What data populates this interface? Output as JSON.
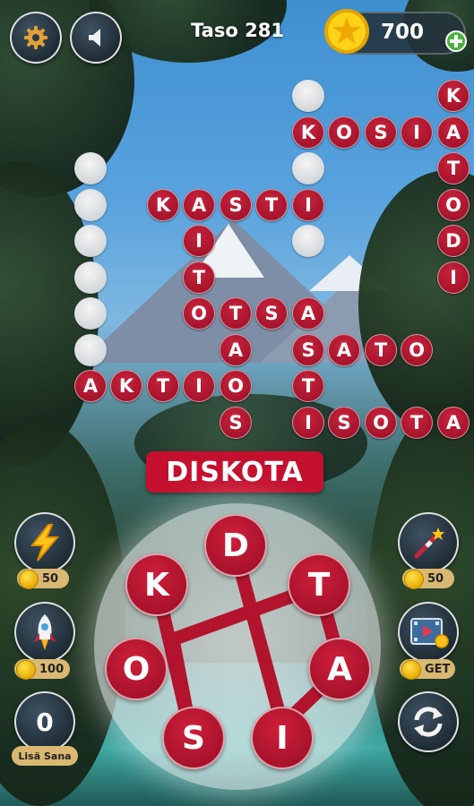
{
  "header": {
    "level_label": "Taso 281",
    "coins": "700"
  },
  "icons": {
    "settings": "gear-icon",
    "sound": "speaker-icon",
    "coin": "coin-icon",
    "add_coins": "plus-icon",
    "lightning": "lightning-icon",
    "rocket": "rocket-icon",
    "wand": "magic-wand-icon",
    "video": "video-icon",
    "shuffle": "shuffle-icon"
  },
  "current_word": "DISKOTA",
  "board": {
    "filled_tiles": [
      {
        "letter": "K",
        "col": 11,
        "row": 0
      },
      {
        "letter": "K",
        "col": 7,
        "row": 1
      },
      {
        "letter": "O",
        "col": 8,
        "row": 1
      },
      {
        "letter": "S",
        "col": 9,
        "row": 1
      },
      {
        "letter": "I",
        "col": 10,
        "row": 1
      },
      {
        "letter": "A",
        "col": 11,
        "row": 1
      },
      {
        "letter": "T",
        "col": 11,
        "row": 2
      },
      {
        "letter": "K",
        "col": 3,
        "row": 3
      },
      {
        "letter": "A",
        "col": 4,
        "row": 3
      },
      {
        "letter": "S",
        "col": 5,
        "row": 3
      },
      {
        "letter": "T",
        "col": 6,
        "row": 3
      },
      {
        "letter": "I",
        "col": 7,
        "row": 3
      },
      {
        "letter": "O",
        "col": 11,
        "row": 3
      },
      {
        "letter": "I",
        "col": 4,
        "row": 4
      },
      {
        "letter": "D",
        "col": 11,
        "row": 4
      },
      {
        "letter": "T",
        "col": 4,
        "row": 5
      },
      {
        "letter": "I",
        "col": 11,
        "row": 5
      },
      {
        "letter": "O",
        "col": 4,
        "row": 6
      },
      {
        "letter": "T",
        "col": 5,
        "row": 6
      },
      {
        "letter": "S",
        "col": 6,
        "row": 6
      },
      {
        "letter": "A",
        "col": 7,
        "row": 6
      },
      {
        "letter": "A",
        "col": 5,
        "row": 7
      },
      {
        "letter": "S",
        "col": 7,
        "row": 7
      },
      {
        "letter": "A",
        "col": 8,
        "row": 7
      },
      {
        "letter": "T",
        "col": 9,
        "row": 7
      },
      {
        "letter": "O",
        "col": 10,
        "row": 7
      },
      {
        "letter": "A",
        "col": 1,
        "row": 8
      },
      {
        "letter": "K",
        "col": 2,
        "row": 8
      },
      {
        "letter": "T",
        "col": 3,
        "row": 8
      },
      {
        "letter": "I",
        "col": 4,
        "row": 8
      },
      {
        "letter": "O",
        "col": 5,
        "row": 8
      },
      {
        "letter": "T",
        "col": 7,
        "row": 8
      },
      {
        "letter": "S",
        "col": 5,
        "row": 9
      },
      {
        "letter": "I",
        "col": 7,
        "row": 9
      },
      {
        "letter": "S",
        "col": 8,
        "row": 9
      },
      {
        "letter": "O",
        "col": 9,
        "row": 9
      },
      {
        "letter": "T",
        "col": 10,
        "row": 9
      },
      {
        "letter": "A",
        "col": 11,
        "row": 9
      }
    ],
    "empty_tiles": [
      {
        "col": 7,
        "row": 0
      },
      {
        "col": 7,
        "row": 2
      },
      {
        "col": 7,
        "row": 4
      },
      {
        "col": 1,
        "row": 2
      },
      {
        "col": 1,
        "row": 3
      },
      {
        "col": 1,
        "row": 4
      },
      {
        "col": 1,
        "row": 5
      },
      {
        "col": 1,
        "row": 6
      },
      {
        "col": 1,
        "row": 7
      }
    ]
  },
  "wheel_letters": [
    "D",
    "T",
    "A",
    "I",
    "S",
    "O",
    "K"
  ],
  "boosters": {
    "lightning_price": "50",
    "rocket_price": "100",
    "wand_price": "50",
    "video_label": "GET",
    "extra_word_count": "0",
    "extra_word_label": "Lisä Sana"
  },
  "colors": {
    "tile_red": "#b8162f",
    "banner_red": "#c4102e",
    "coin_gold": "#f5c400"
  }
}
